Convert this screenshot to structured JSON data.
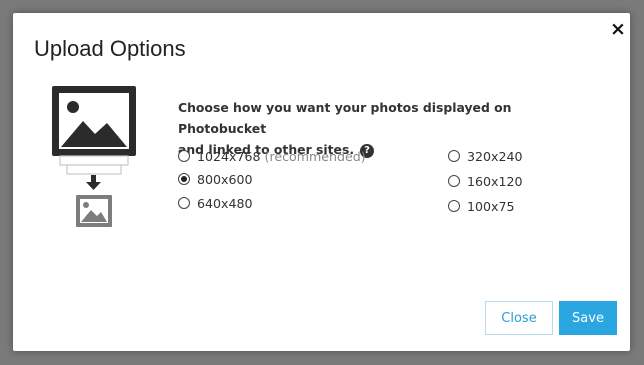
{
  "dialog": {
    "title": "Upload Options",
    "close_icon": "×"
  },
  "prompt": {
    "line1": "Choose how you want your photos displayed on Photobucket",
    "line2": "and linked to other sites.",
    "help_icon": "?"
  },
  "options": {
    "left": [
      {
        "label": "1024x768",
        "note": "(recommended)",
        "checked": false
      },
      {
        "label": "800x600",
        "checked": true
      },
      {
        "label": "640x480",
        "checked": false
      }
    ],
    "right": [
      {
        "label": "320x240",
        "checked": false
      },
      {
        "label": "160x120",
        "checked": false
      },
      {
        "label": "100x75",
        "checked": false
      }
    ]
  },
  "buttons": {
    "close": "Close",
    "save": "Save"
  },
  "colors": {
    "accent": "#2aa6e0",
    "backdrop": "#7a7a7a"
  }
}
